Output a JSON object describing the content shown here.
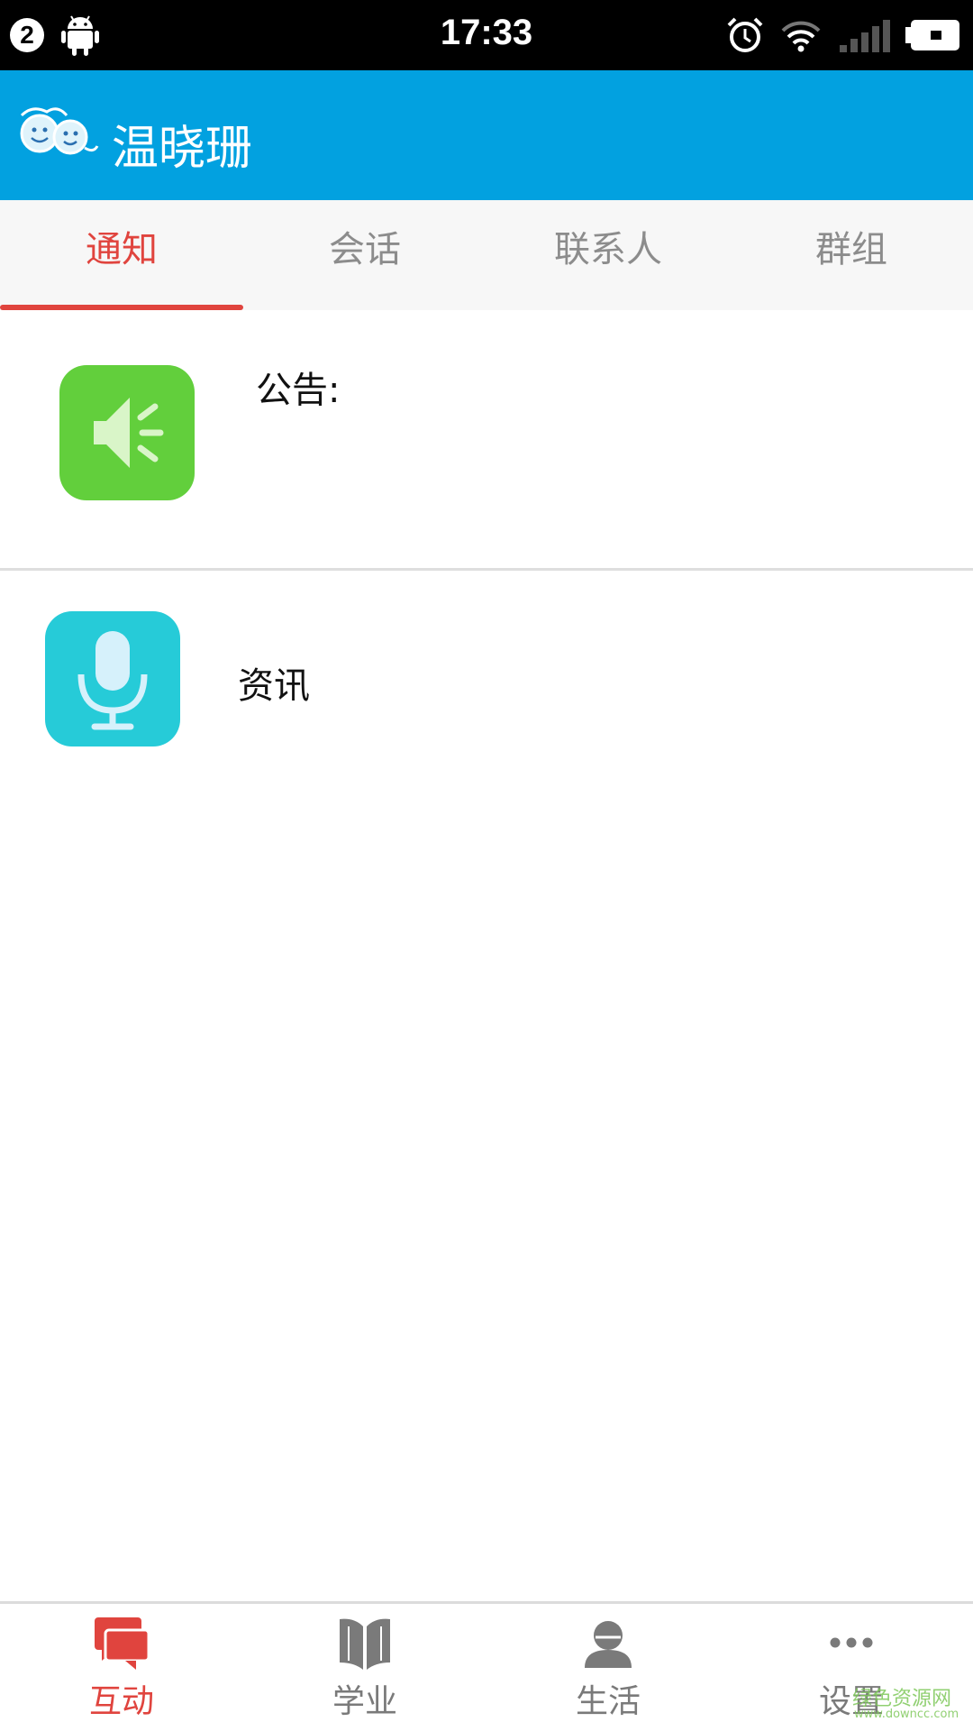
{
  "status_bar": {
    "notification_count": "2",
    "time": "17:33",
    "icons": [
      "android-icon",
      "alarm-icon",
      "wifi-icon",
      "signal-icon",
      "battery-charging-icon"
    ]
  },
  "header": {
    "title": "温晓珊",
    "logo_icon": "kids-faces-logo"
  },
  "tabs": [
    {
      "label": "通知",
      "active": true
    },
    {
      "label": "会话",
      "active": false
    },
    {
      "label": "联系人",
      "active": false
    },
    {
      "label": "群组",
      "active": false
    }
  ],
  "list": [
    {
      "label": "公告:",
      "icon": "speaker-icon",
      "icon_color": "#62cf3c"
    },
    {
      "label": "资讯",
      "icon": "microphone-icon",
      "icon_color": "#26cbd8"
    }
  ],
  "bottom_nav": [
    {
      "label": "互动",
      "icon": "chat-bubbles-icon",
      "active": true
    },
    {
      "label": "学业",
      "icon": "book-icon",
      "active": false
    },
    {
      "label": "生活",
      "icon": "person-icon",
      "active": false
    },
    {
      "label": "设置",
      "icon": "more-dots-icon",
      "active": false
    }
  ],
  "watermark": {
    "text": "绿色资源网",
    "url_text": "www.downcc.com"
  },
  "colors": {
    "header_bg": "#02a1e0",
    "accent": "#e0443e",
    "inactive": "#7a7a7a"
  }
}
